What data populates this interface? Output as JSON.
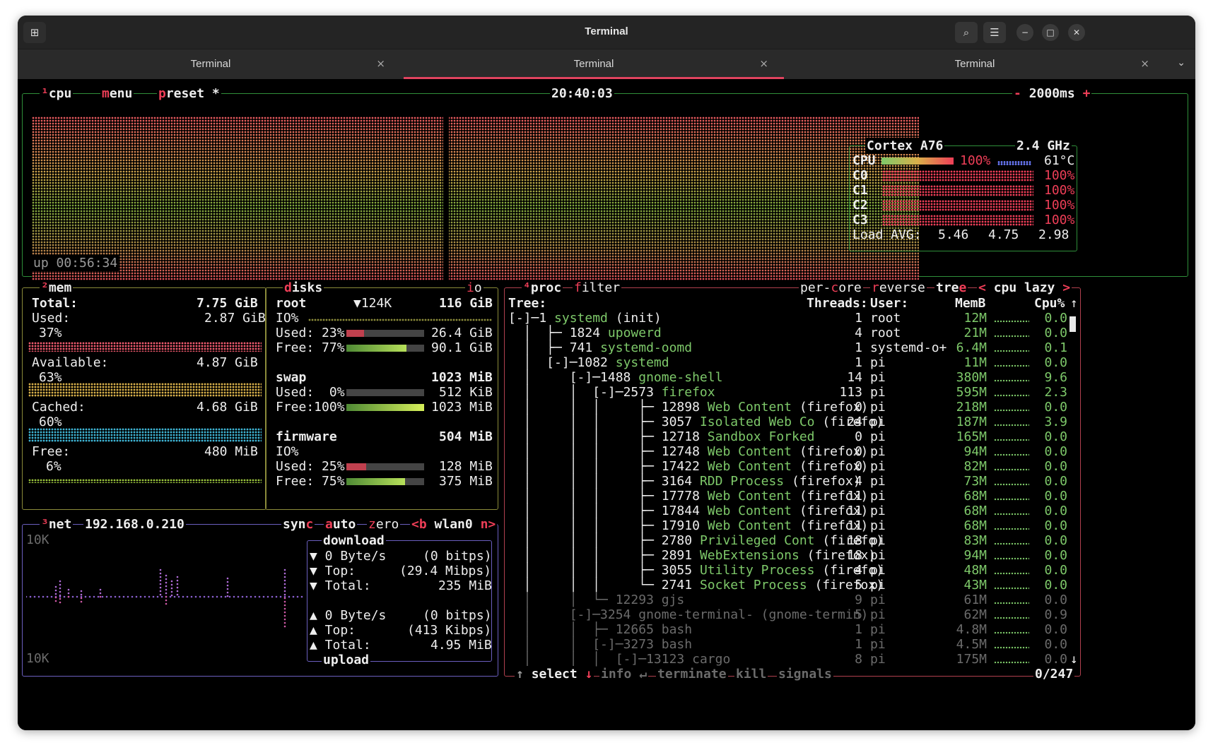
{
  "window": {
    "title": "Terminal"
  },
  "tabs": [
    {
      "label": "Terminal",
      "active": false
    },
    {
      "label": "Terminal",
      "active": true
    },
    {
      "label": "Terminal",
      "active": false
    }
  ],
  "icons": {
    "new_tab": "new-tab-icon",
    "search": "search-icon",
    "menu": "hamburger-menu-icon",
    "minimize": "minimize-icon",
    "maximize": "maximize-icon",
    "close": "close-icon",
    "tab_close": "close-icon",
    "tab_overflow": "chevron-down-icon"
  },
  "colors": {
    "accent": "#e0435e",
    "box_cpu": "#2f8f3a",
    "box_mem": "#8b8b3a",
    "box_net": "#6b5fbf",
    "box_proc": "#b0404e",
    "label_red": "#ee3e57",
    "proc_name": "#7ec96a"
  },
  "cpu": {
    "tag": "¹",
    "title": "cpu",
    "menu": "menu",
    "preset": "preset *",
    "clock": "20:40:03",
    "minus": "-",
    "interval": "2000ms",
    "plus": "+",
    "uptime": "up 00:56:34",
    "model": "Cortex A76",
    "freq": "2.4 GHz",
    "total": {
      "label": "CPU",
      "pct": "100%",
      "temp": "61°C",
      "fraction": 1.0
    },
    "cores": [
      {
        "label": "C0",
        "pct": "100%"
      },
      {
        "label": "C1",
        "pct": "100%"
      },
      {
        "label": "C2",
        "pct": "100%"
      },
      {
        "label": "C3",
        "pct": "100%"
      }
    ],
    "load": {
      "label": "Load AVG:",
      "v1": "5.46",
      "v5": "4.75",
      "v15": "2.98"
    }
  },
  "mem": {
    "tag": "²",
    "title": "mem",
    "total_label": "Total:",
    "total": "7.75 GiB",
    "used_label": "Used:",
    "used": "2.87 GiB",
    "used_pct": "37%",
    "avail_label": "Available:",
    "avail": "4.87 GiB",
    "avail_pct": "63%",
    "cached_label": "Cached:",
    "cached": "4.68 GiB",
    "cached_pct": "60%",
    "free_label": "Free:",
    "free": "480 MiB",
    "free_pct": "6%"
  },
  "disks": {
    "title": "disks",
    "io_label": "io",
    "root": {
      "name": "root",
      "io_rate": "▼124K",
      "size": "116 GiB",
      "io": "IO%",
      "used_label": "Used: 23%",
      "used": "26.4 GiB",
      "used_frac": 0.23,
      "free_label": "Free: 77%",
      "free": "90.1 GiB",
      "free_frac": 0.77
    },
    "swap": {
      "name": "swap",
      "size": "1023 MiB",
      "used_label": "Used:  0%",
      "used": "512 KiB",
      "used_frac": 0.0,
      "free_label": "Free:100%",
      "free": "1023 MiB",
      "free_frac": 1.0
    },
    "firmware": {
      "name": "firmware",
      "size": "504 MiB",
      "io": "IO%",
      "used_label": "Used: 25%",
      "used": "128 MiB",
      "used_frac": 0.25,
      "free_label": "Free: 75%",
      "free": "375 MiB",
      "free_frac": 0.75
    }
  },
  "net": {
    "tag": "³",
    "title": "net",
    "ip": "192.168.0.210",
    "sync": "sync",
    "auto": "auto",
    "zero": "zero",
    "prev": "<b",
    "iface": "wlan0",
    "next": "n>",
    "scale_top": "10K",
    "scale_bottom": "10K",
    "download": {
      "title": "download",
      "rate": "▼ 0 Byte/s",
      "bits": "(0 bitps)",
      "top_label": "▼ Top:",
      "top": "(29.4 Mibps)",
      "total_label": "▼ Total:",
      "total": "235 MiB"
    },
    "upload": {
      "title": "upload",
      "rate": "▲ 0 Byte/s",
      "bits": "(0 bitps)",
      "top_label": "▲ Top:",
      "top": "(413 Kibps)",
      "total_label": "▲ Total:",
      "total": "4.95 MiB"
    }
  },
  "proc": {
    "tag": "⁴",
    "title": "proc",
    "filter": "filter",
    "per_core": "per-core",
    "reverse": "reverse",
    "tree": "tree",
    "sort_prev": "<",
    "sort": "cpu lazy",
    "sort_next": ">",
    "headers": {
      "tree": "Tree:",
      "threads": "Threads:",
      "user": "User:",
      "mem": "MemB",
      "cpu": "Cpu%"
    },
    "rows": [
      {
        "prefix": "[-]─1 ",
        "pid": "",
        "name": "systemd",
        "args": " (init)",
        "threads": "1",
        "user": "root",
        "mem": "12M",
        "cpu": "0.0"
      },
      {
        "prefix": "  │  ├─ ",
        "pid": "1824 ",
        "name": "upowerd",
        "args": "",
        "threads": "4",
        "user": "root",
        "mem": "21M",
        "cpu": "0.0"
      },
      {
        "prefix": "  │  ├─ ",
        "pid": "741 ",
        "name": "systemd-oomd",
        "args": "",
        "threads": "1",
        "user": "systemd-o+",
        "mem": "6.4M",
        "cpu": "0.1"
      },
      {
        "prefix": "  │  [-]─",
        "pid": "1082 ",
        "name": "systemd",
        "args": "",
        "threads": "1",
        "user": "pi",
        "mem": "11M",
        "cpu": "0.0"
      },
      {
        "prefix": "  │     [-]─",
        "pid": "1488 ",
        "name": "gnome-shell",
        "args": "",
        "threads": "14",
        "user": "pi",
        "mem": "380M",
        "cpu": "9.6"
      },
      {
        "prefix": "  │     │  [-]─",
        "pid": "2573 ",
        "name": "firefox",
        "args": "",
        "threads": "113",
        "user": "pi",
        "mem": "595M",
        "cpu": "2.3"
      },
      {
        "prefix": "  │     │  │     ├─ ",
        "pid": "12898 ",
        "name": "Web Content",
        "args": " (firefox)",
        "threads": "0",
        "user": "pi",
        "mem": "218M",
        "cpu": "0.0"
      },
      {
        "prefix": "  │     │  │     ├─ ",
        "pid": "3057 ",
        "name": "Isolated Web Co",
        "args": " (firefo)",
        "threads": "24",
        "user": "pi",
        "mem": "187M",
        "cpu": "3.9"
      },
      {
        "prefix": "  │     │  │     ├─ ",
        "pid": "12718 ",
        "name": "Sandbox Forked",
        "args": "",
        "threads": "0",
        "user": "pi",
        "mem": "165M",
        "cpu": "0.0"
      },
      {
        "prefix": "  │     │  │     ├─ ",
        "pid": "12748 ",
        "name": "Web Content",
        "args": " (firefox)",
        "threads": "0",
        "user": "pi",
        "mem": "94M",
        "cpu": "0.0"
      },
      {
        "prefix": "  │     │  │     ├─ ",
        "pid": "17422 ",
        "name": "Web Content",
        "args": " (firefox)",
        "threads": "0",
        "user": "pi",
        "mem": "82M",
        "cpu": "0.0"
      },
      {
        "prefix": "  │     │  │     ├─ ",
        "pid": "3164 ",
        "name": "RDD Process",
        "args": " (firefox)",
        "threads": "4",
        "user": "pi",
        "mem": "73M",
        "cpu": "0.0"
      },
      {
        "prefix": "  │     │  │     ├─ ",
        "pid": "17778 ",
        "name": "Web Content",
        "args": " (firefox)",
        "threads": "11",
        "user": "pi",
        "mem": "68M",
        "cpu": "0.0"
      },
      {
        "prefix": "  │     │  │     ├─ ",
        "pid": "17844 ",
        "name": "Web Content",
        "args": " (firefox)",
        "threads": "11",
        "user": "pi",
        "mem": "68M",
        "cpu": "0.0"
      },
      {
        "prefix": "  │     │  │     ├─ ",
        "pid": "17910 ",
        "name": "Web Content",
        "args": " (firefox)",
        "threads": "11",
        "user": "pi",
        "mem": "68M",
        "cpu": "0.0"
      },
      {
        "prefix": "  │     │  │     ├─ ",
        "pid": "2780 ",
        "name": "Privileged Cont",
        "args": " (firefo)",
        "threads": "18",
        "user": "pi",
        "mem": "83M",
        "cpu": "0.0"
      },
      {
        "prefix": "  │     │  │     ├─ ",
        "pid": "2891 ",
        "name": "WebExtensions",
        "args": " (firefox)",
        "threads": "18",
        "user": "pi",
        "mem": "94M",
        "cpu": "0.0"
      },
      {
        "prefix": "  │     │  │     ├─ ",
        "pid": "3055 ",
        "name": "Utility Process",
        "args": " (firefo)",
        "threads": "4",
        "user": "pi",
        "mem": "48M",
        "cpu": "0.0"
      },
      {
        "prefix": "  │     │  │     └─ ",
        "pid": "2741 ",
        "name": "Socket Process",
        "args": " (firefox)",
        "threads": "5",
        "user": "pi",
        "mem": "43M",
        "cpu": "0.0"
      },
      {
        "prefix": "  │     │  └─ ",
        "pid": "12293 ",
        "name": "gjs",
        "args": "",
        "threads": "9",
        "user": "pi",
        "mem": "61M",
        "cpu": "0.0"
      },
      {
        "prefix": "  │     [-]─",
        "pid": "3254 ",
        "name": "gnome-terminal-",
        "args": " (gnome-termin)",
        "threads": "5",
        "user": "pi",
        "mem": "62M",
        "cpu": "0.9"
      },
      {
        "prefix": "  │     │  ├─ ",
        "pid": "12665 ",
        "name": "bash",
        "args": "",
        "threads": "1",
        "user": "pi",
        "mem": "4.8M",
        "cpu": "0.0"
      },
      {
        "prefix": "  │     │  [-]─",
        "pid": "3273 ",
        "name": "bash",
        "args": "",
        "threads": "1",
        "user": "pi",
        "mem": "4.5M",
        "cpu": "0.0"
      },
      {
        "prefix": "  │     │  │  [-]─",
        "pid": "13123 ",
        "name": "cargo",
        "args": "",
        "threads": "8",
        "user": "pi",
        "mem": "175M",
        "cpu": "0.0"
      }
    ],
    "footer": {
      "up": "↑",
      "select": "select",
      "down": "↓",
      "info": "info",
      "enter": "↵",
      "terminate": "terminate",
      "kill": "kill",
      "signals": "signals",
      "count": "0/247"
    }
  }
}
